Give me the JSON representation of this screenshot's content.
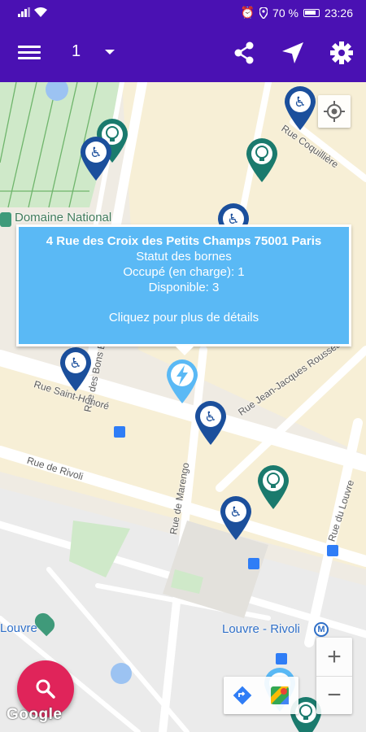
{
  "status_bar": {
    "battery_percent": "70 %",
    "time": "23:26",
    "icons": [
      "signal-icon",
      "wifi-icon",
      "alarm-icon",
      "location-icon",
      "battery-icon"
    ]
  },
  "app_bar": {
    "selector_value": "1",
    "icons": [
      "menu-icon",
      "share-icon",
      "navigation-arrow-icon",
      "settings-icon"
    ],
    "color": "#4a11b3"
  },
  "map": {
    "streets": [
      "Rue des Croix des Petits Champs",
      "Rue Coquillière",
      "Rue des Bons Enfants",
      "Rue Jean-Jacques Rousseau",
      "Rue Saint-Honoré",
      "Rue de Rivoli",
      "Rue de Marengo",
      "Rue du Louvre"
    ],
    "pois": {
      "domaine_national": "Domaine National",
      "louvre": "Louvre",
      "louvre_rivoli": "Louvre - Rivoli",
      "metro_badge": "M"
    },
    "google_logo": "Google"
  },
  "popup": {
    "address": "4 Rue des Croix des Petits Champs 75001 Paris",
    "status_heading": "Statut des bornes",
    "occupied": "Occupé (en charge): 1",
    "available": "Disponible: 3",
    "details_link": "Cliquez pour plus de détails",
    "color": "#5ab9f5"
  },
  "markers": {
    "types": [
      "accessible-parking",
      "charging-station",
      "charging-selected"
    ],
    "colors": {
      "accessible": "#1b4f9c",
      "charging": "#1a7a6d",
      "selected": "#5ab9f5"
    }
  },
  "fab": {
    "icon": "search-icon",
    "color": "#e0245a"
  },
  "zoom": {
    "in": "+",
    "out": "−"
  }
}
